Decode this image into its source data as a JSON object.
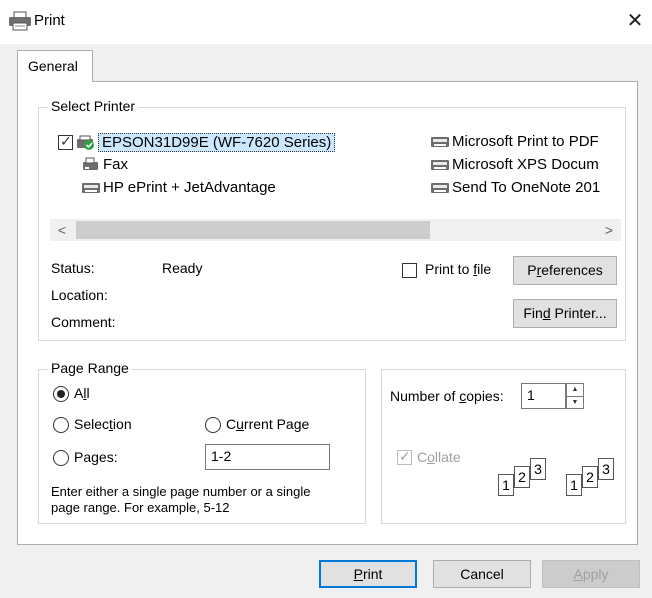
{
  "window": {
    "title": "Print",
    "close_glyph": "✕"
  },
  "tabs": [
    {
      "label": "General"
    }
  ],
  "select_printer": {
    "legend": "Select Printer",
    "printers": [
      {
        "name": "EPSON31D99E (WF-7620 Series)",
        "icon": "printer-default-icon",
        "selected": true
      },
      {
        "name": "Fax",
        "icon": "fax-icon"
      },
      {
        "name": "HP ePrint + JetAdvantage",
        "icon": "printer-icon"
      },
      {
        "name": "Microsoft Print to PDF",
        "icon": "printer-icon"
      },
      {
        "name": "Microsoft XPS Docum",
        "icon": "printer-icon"
      },
      {
        "name": "Send To OneNote 201",
        "icon": "printer-icon"
      }
    ],
    "scroll_left": "<",
    "scroll_right": ">"
  },
  "status": {
    "status_label": "Status:",
    "status_value": "Ready",
    "location_label": "Location:",
    "comment_label": "Comment:"
  },
  "print_to_file": {
    "label_pre": "Print to ",
    "label_u": "f",
    "label_post": "ile",
    "checked": false
  },
  "preferences_button": {
    "pre": "P",
    "u": "r",
    "post": "eferences"
  },
  "find_printer_button": {
    "pre": "Fin",
    "u": "d",
    "post": " Printer..."
  },
  "page_range": {
    "legend": "Page Range",
    "all": {
      "pre": "A",
      "u": "l",
      "post": "l"
    },
    "selection": {
      "pre": "Selec",
      "u": "t",
      "post": "ion"
    },
    "current_page": {
      "pre": "C",
      "u": "u",
      "post": "rrent Page"
    },
    "pages": {
      "pre": "Pa",
      "u": "g",
      "post": "es:"
    },
    "pages_value": "1-2",
    "hint_line1": "Enter either a single page number or a single",
    "hint_line2": "page range.  For example, 5-12"
  },
  "copies": {
    "label_pre": "Number of ",
    "label_u": "c",
    "label_post": "opies:",
    "value": "1",
    "collate_pre": "C",
    "collate_u": "o",
    "collate_post": "llate",
    "collate_checked": true,
    "collate_enabled": false,
    "page_numbers": [
      "1",
      "2",
      "3"
    ]
  },
  "buttons": {
    "print": {
      "pre": "",
      "u": "P",
      "post": "rint"
    },
    "cancel": "Cancel",
    "apply": {
      "pre": "",
      "u": "A",
      "post": "pply"
    }
  },
  "colors": {
    "accent": "#0078d7",
    "selection": "#cce8ff",
    "check_green": "#2ea043"
  }
}
